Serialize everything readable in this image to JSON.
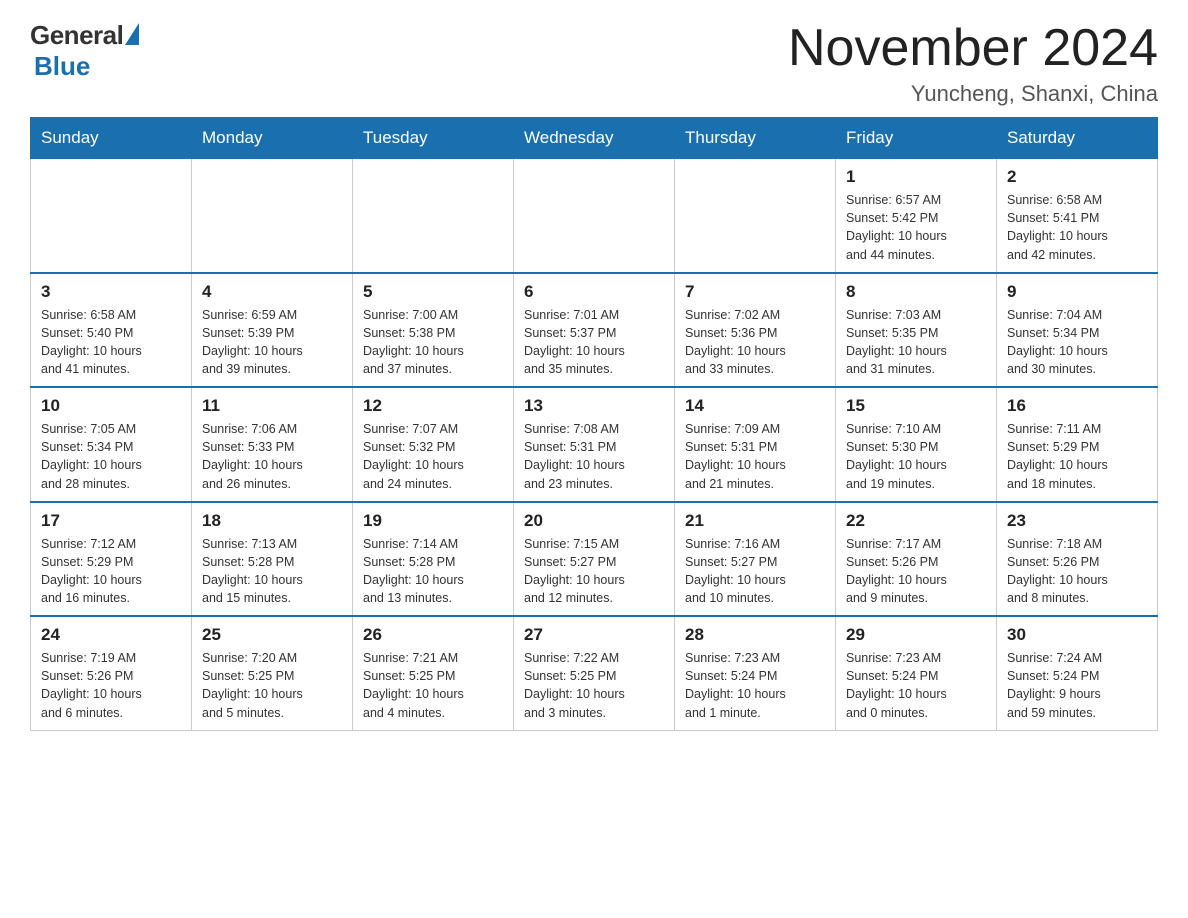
{
  "header": {
    "logo": {
      "general": "General",
      "blue": "Blue"
    },
    "title": "November 2024",
    "subtitle": "Yuncheng, Shanxi, China"
  },
  "days_of_week": [
    "Sunday",
    "Monday",
    "Tuesday",
    "Wednesday",
    "Thursday",
    "Friday",
    "Saturday"
  ],
  "weeks": [
    {
      "days": [
        {
          "num": "",
          "info": ""
        },
        {
          "num": "",
          "info": ""
        },
        {
          "num": "",
          "info": ""
        },
        {
          "num": "",
          "info": ""
        },
        {
          "num": "",
          "info": ""
        },
        {
          "num": "1",
          "info": "Sunrise: 6:57 AM\nSunset: 5:42 PM\nDaylight: 10 hours\nand 44 minutes."
        },
        {
          "num": "2",
          "info": "Sunrise: 6:58 AM\nSunset: 5:41 PM\nDaylight: 10 hours\nand 42 minutes."
        }
      ]
    },
    {
      "days": [
        {
          "num": "3",
          "info": "Sunrise: 6:58 AM\nSunset: 5:40 PM\nDaylight: 10 hours\nand 41 minutes."
        },
        {
          "num": "4",
          "info": "Sunrise: 6:59 AM\nSunset: 5:39 PM\nDaylight: 10 hours\nand 39 minutes."
        },
        {
          "num": "5",
          "info": "Sunrise: 7:00 AM\nSunset: 5:38 PM\nDaylight: 10 hours\nand 37 minutes."
        },
        {
          "num": "6",
          "info": "Sunrise: 7:01 AM\nSunset: 5:37 PM\nDaylight: 10 hours\nand 35 minutes."
        },
        {
          "num": "7",
          "info": "Sunrise: 7:02 AM\nSunset: 5:36 PM\nDaylight: 10 hours\nand 33 minutes."
        },
        {
          "num": "8",
          "info": "Sunrise: 7:03 AM\nSunset: 5:35 PM\nDaylight: 10 hours\nand 31 minutes."
        },
        {
          "num": "9",
          "info": "Sunrise: 7:04 AM\nSunset: 5:34 PM\nDaylight: 10 hours\nand 30 minutes."
        }
      ]
    },
    {
      "days": [
        {
          "num": "10",
          "info": "Sunrise: 7:05 AM\nSunset: 5:34 PM\nDaylight: 10 hours\nand 28 minutes."
        },
        {
          "num": "11",
          "info": "Sunrise: 7:06 AM\nSunset: 5:33 PM\nDaylight: 10 hours\nand 26 minutes."
        },
        {
          "num": "12",
          "info": "Sunrise: 7:07 AM\nSunset: 5:32 PM\nDaylight: 10 hours\nand 24 minutes."
        },
        {
          "num": "13",
          "info": "Sunrise: 7:08 AM\nSunset: 5:31 PM\nDaylight: 10 hours\nand 23 minutes."
        },
        {
          "num": "14",
          "info": "Sunrise: 7:09 AM\nSunset: 5:31 PM\nDaylight: 10 hours\nand 21 minutes."
        },
        {
          "num": "15",
          "info": "Sunrise: 7:10 AM\nSunset: 5:30 PM\nDaylight: 10 hours\nand 19 minutes."
        },
        {
          "num": "16",
          "info": "Sunrise: 7:11 AM\nSunset: 5:29 PM\nDaylight: 10 hours\nand 18 minutes."
        }
      ]
    },
    {
      "days": [
        {
          "num": "17",
          "info": "Sunrise: 7:12 AM\nSunset: 5:29 PM\nDaylight: 10 hours\nand 16 minutes."
        },
        {
          "num": "18",
          "info": "Sunrise: 7:13 AM\nSunset: 5:28 PM\nDaylight: 10 hours\nand 15 minutes."
        },
        {
          "num": "19",
          "info": "Sunrise: 7:14 AM\nSunset: 5:28 PM\nDaylight: 10 hours\nand 13 minutes."
        },
        {
          "num": "20",
          "info": "Sunrise: 7:15 AM\nSunset: 5:27 PM\nDaylight: 10 hours\nand 12 minutes."
        },
        {
          "num": "21",
          "info": "Sunrise: 7:16 AM\nSunset: 5:27 PM\nDaylight: 10 hours\nand 10 minutes."
        },
        {
          "num": "22",
          "info": "Sunrise: 7:17 AM\nSunset: 5:26 PM\nDaylight: 10 hours\nand 9 minutes."
        },
        {
          "num": "23",
          "info": "Sunrise: 7:18 AM\nSunset: 5:26 PM\nDaylight: 10 hours\nand 8 minutes."
        }
      ]
    },
    {
      "days": [
        {
          "num": "24",
          "info": "Sunrise: 7:19 AM\nSunset: 5:26 PM\nDaylight: 10 hours\nand 6 minutes."
        },
        {
          "num": "25",
          "info": "Sunrise: 7:20 AM\nSunset: 5:25 PM\nDaylight: 10 hours\nand 5 minutes."
        },
        {
          "num": "26",
          "info": "Sunrise: 7:21 AM\nSunset: 5:25 PM\nDaylight: 10 hours\nand 4 minutes."
        },
        {
          "num": "27",
          "info": "Sunrise: 7:22 AM\nSunset: 5:25 PM\nDaylight: 10 hours\nand 3 minutes."
        },
        {
          "num": "28",
          "info": "Sunrise: 7:23 AM\nSunset: 5:24 PM\nDaylight: 10 hours\nand 1 minute."
        },
        {
          "num": "29",
          "info": "Sunrise: 7:23 AM\nSunset: 5:24 PM\nDaylight: 10 hours\nand 0 minutes."
        },
        {
          "num": "30",
          "info": "Sunrise: 7:24 AM\nSunset: 5:24 PM\nDaylight: 9 hours\nand 59 minutes."
        }
      ]
    }
  ]
}
